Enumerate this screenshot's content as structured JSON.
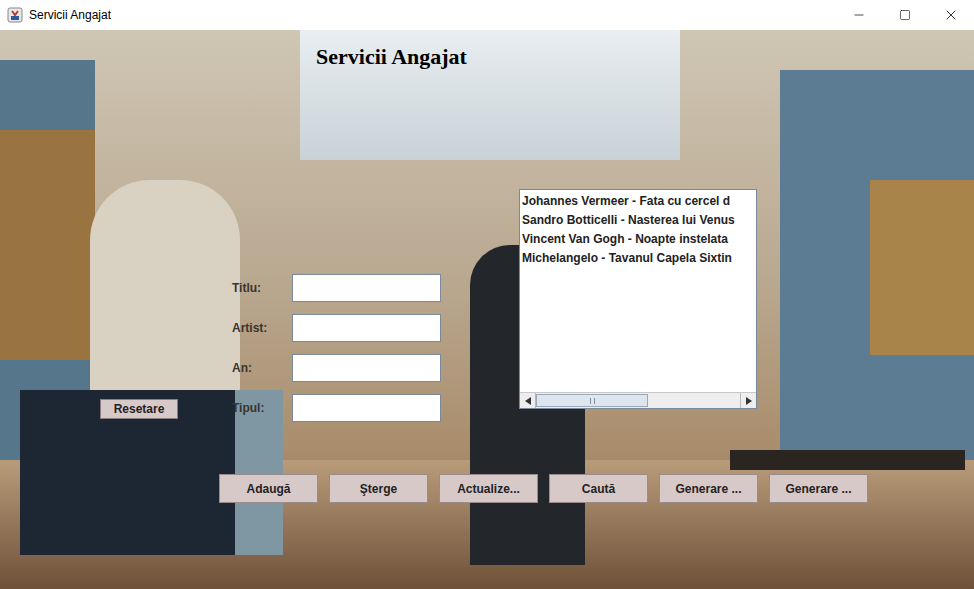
{
  "window": {
    "title": "Servicii Angajat"
  },
  "heading": "Servicii Angajat",
  "form": {
    "fields": [
      {
        "label": "Titlu:"
      },
      {
        "label": "Artist:"
      },
      {
        "label": "An:"
      },
      {
        "label": "Tipul:"
      }
    ]
  },
  "reset_button": "Resetare",
  "list": {
    "items": [
      {
        "text": "Johannes Vermeer - Fata cu cercel d",
        "selected": false
      },
      {
        "text": "Sandro Botticelli - Nasterea lui Venus",
        "selected": false
      },
      {
        "text": "Vincent Van Gogh - Noapte instelata",
        "selected": false
      },
      {
        "text": "Michelangelo - Tavanul Capela Sixtin",
        "selected": false
      }
    ],
    "scrollbar": {
      "level": 0.55
    }
  },
  "buttons": [
    "Adaugă",
    "Şterge",
    "Actualize...",
    "Caută",
    "Generare ...",
    "Generare ..."
  ]
}
